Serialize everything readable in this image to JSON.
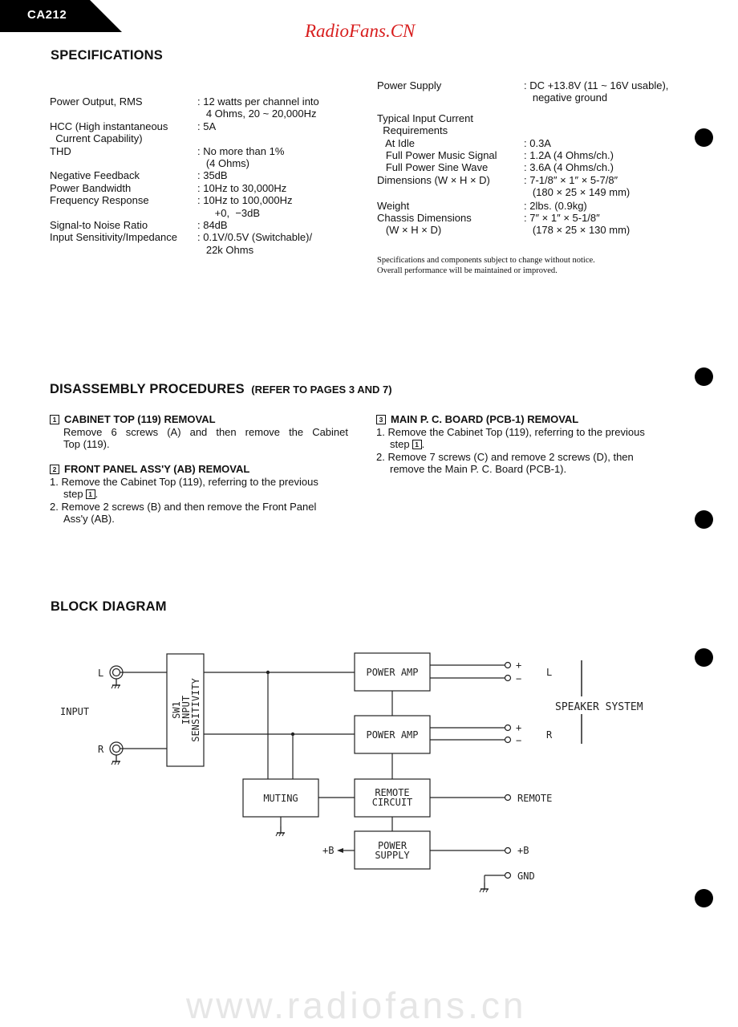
{
  "header": {
    "model_tab": "CA212",
    "watermark_top": "RadioFans.CN",
    "watermark_bottom": "www.radiofans.cn"
  },
  "specifications": {
    "title": "SPECIFICATIONS",
    "left": [
      {
        "label": "Power Output, RMS",
        "value": ": 12 watts per channel into\n   4 Ohms, 20 ~ 20,000Hz"
      },
      {
        "label": "HCC (High instantaneous\n  Current Capability)",
        "value": ": 5A"
      },
      {
        "label": "THD",
        "value": ": No more than 1%\n   (4 Ohms)"
      },
      {
        "label": "Negative Feedback",
        "value": ": 35dB"
      },
      {
        "label": "Power Bandwidth",
        "value": ": 10Hz to 30,000Hz"
      },
      {
        "label": "Frequency Response",
        "value": ": 10Hz to 100,000Hz\n      +0,  −3dB"
      },
      {
        "label": "Signal-to Noise Ratio",
        "value": ": 84dB"
      },
      {
        "label": "Input Sensitivity/Impedance",
        "value": ": 0.1V/0.5V (Switchable)/\n   22k Ohms"
      }
    ],
    "right": [
      {
        "label": "Power Supply",
        "value": ": DC +13.8V (11 ~ 16V usable),\n   negative ground"
      },
      {
        "label": "Typical Input Current\n  Requirements\n   At Idle",
        "value": "\n\n: 0.3A"
      },
      {
        "label": "   Full Power Music Signal",
        "value": ": 1.2A (4 Ohms/ch.)"
      },
      {
        "label": "   Full Power Sine Wave",
        "value": ": 3.6A (4 Ohms/ch.)"
      },
      {
        "label": "Dimensions (W × H × D)",
        "value": ": 7-1/8″ × 1″ × 5-7/8″\n   (180 × 25 × 149 mm)"
      },
      {
        "label": "Weight",
        "value": ": 2lbs. (0.9kg)"
      },
      {
        "label": "Chassis Dimensions\n   (W × H × D)",
        "value": ": 7″ × 1″ × 5-1/8″\n   (178 × 25 × 130 mm)"
      }
    ],
    "note_line1": "Specifications and components subject to change without notice.",
    "note_line2": "Overall performance will be maintained or improved."
  },
  "disassembly": {
    "title": "DISASSEMBLY PROCEDURES",
    "subtitle": "(REFER TO PAGES 3 AND 7)",
    "steps": [
      {
        "num": "1",
        "title": "CABINET TOP (119) REMOVAL",
        "lines": [
          "Remove 6 screws (A) and then remove the Cabinet",
          "Top (119)."
        ]
      },
      {
        "num": "2",
        "title": "FRONT PANEL ASS'Y (AB) REMOVAL",
        "lines": [
          "1. Remove the Cabinet Top (119), referring to the previous",
          "step",
          "2. Remove 2 screws (B) and then remove the Front Panel",
          "Ass'y (AB)."
        ]
      },
      {
        "num": "3",
        "title": "MAIN P. C. BOARD (PCB-1) REMOVAL",
        "lines": [
          "1. Remove the Cabinet Top (119), referring to the previous",
          "step",
          "2. Remove 7 screws (C) and remove 2 screws (D), then",
          "remove the Main P. C. Board (PCB-1)."
        ]
      }
    ],
    "step_ref": "1"
  },
  "block_diagram": {
    "title": "BLOCK DIAGRAM",
    "input_label": "INPUT",
    "ch_left": "L",
    "ch_right": "R",
    "sw_lines": [
      "SW1",
      "INPUT",
      "SENSITIVITY"
    ],
    "power_amp": "POWER AMP",
    "muting": "MUTING",
    "remote_circuit": [
      "REMOTE",
      "CIRCUIT"
    ],
    "power_supply": [
      "POWER",
      "SUPPLY"
    ],
    "speaker_system": "SPEAKER SYSTEM",
    "plus": "+",
    "minus": "−",
    "remote": "REMOTE",
    "plus_b": "+B",
    "gnd": "GND"
  }
}
